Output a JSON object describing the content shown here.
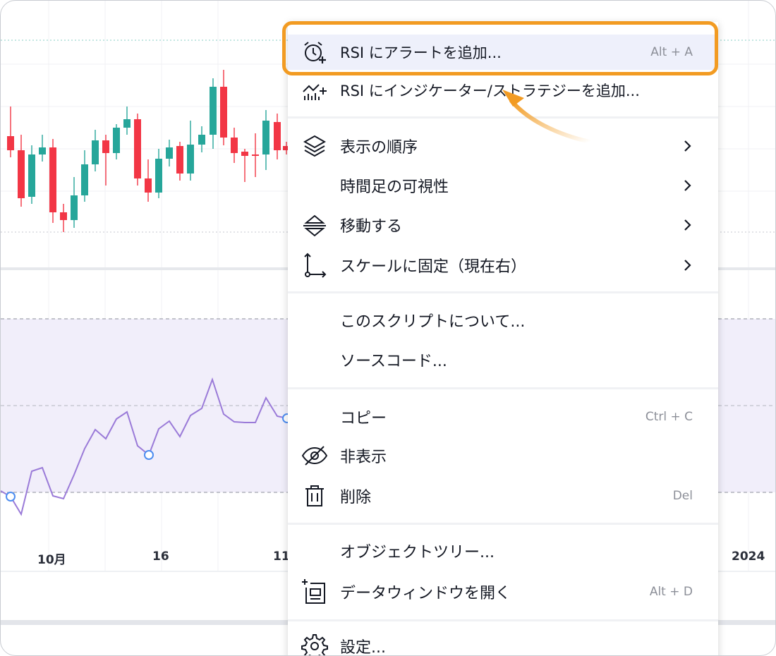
{
  "chart_data": {
    "type": "candlestick",
    "x_ticks": [
      "10月",
      "16",
      "11",
      "2024"
    ],
    "rsi_reference_lines": [
      "upper",
      "middle",
      "lower"
    ]
  },
  "colors": {
    "bull": "#26a69a",
    "bear": "#f23645",
    "rsi_line": "#9a7ad8",
    "rsi_band": "#f1eefa",
    "highlight": "#f29b22",
    "menu_hover": "#eef0fb"
  },
  "menu": {
    "items": [
      {
        "label": "RSI にアラートを追加...",
        "shortcut": "Alt + A",
        "icon": "alarm-clock-plus-icon"
      },
      {
        "label": "RSI にインジケーター/ストラテジーを追加...",
        "shortcut": "",
        "icon": "indicator-plus-icon"
      },
      {
        "label": "表示の順序",
        "shortcut": "",
        "icon": "layers-icon"
      },
      {
        "label": "時間足の可視性",
        "shortcut": "",
        "icon": ""
      },
      {
        "label": "移動する",
        "shortcut": "",
        "icon": "move-pane-icon"
      },
      {
        "label": "スケールに固定（現在右）",
        "shortcut": "",
        "icon": "pin-scale-icon"
      },
      {
        "label": "このスクリプトについて...",
        "shortcut": "",
        "icon": ""
      },
      {
        "label": "ソースコード...",
        "shortcut": "",
        "icon": ""
      },
      {
        "label": "コピー",
        "shortcut": "Ctrl + C",
        "icon": ""
      },
      {
        "label": "非表示",
        "shortcut": "",
        "icon": "eye-crossed-icon"
      },
      {
        "label": "削除",
        "shortcut": "Del",
        "icon": "trash-icon"
      },
      {
        "label": "オブジェクトツリー...",
        "shortcut": "",
        "icon": ""
      },
      {
        "label": "データウィンドウを開く",
        "shortcut": "Alt + D",
        "icon": "data-window-icon"
      },
      {
        "label": "設定...",
        "shortcut": "",
        "icon": "gear-icon"
      }
    ]
  }
}
